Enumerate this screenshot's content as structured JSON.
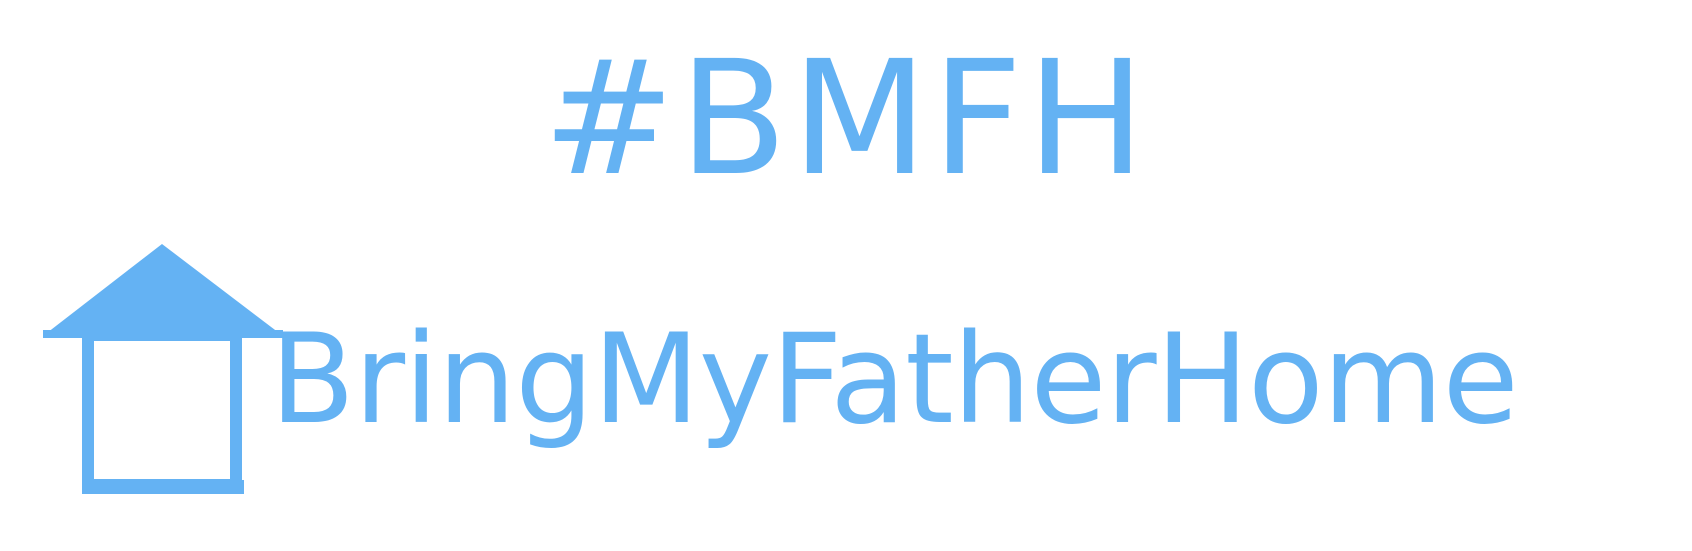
{
  "hashtag": "#BMFH",
  "brand_name": "BringMyFatherHome",
  "logo_icon": "house-outline-icon",
  "colors": {
    "brand_blue": "#64b2f3",
    "background": "#ffffff"
  }
}
